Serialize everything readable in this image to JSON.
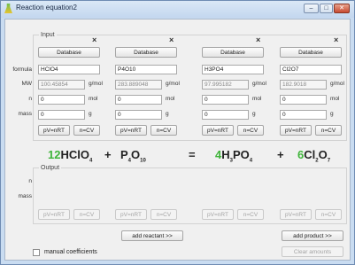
{
  "window": {
    "title": "Reaction equation2",
    "buttons": {
      "minimize": "‒",
      "maximize": "□",
      "close": "✕"
    }
  },
  "input_group": {
    "label": "Input"
  },
  "output_group": {
    "label": "Output"
  },
  "row_labels": {
    "formula": "formula",
    "mw": "MW",
    "n": "n",
    "mass": "mass"
  },
  "output_row_labels": {
    "n": "n",
    "mass": "mass"
  },
  "compounds": [
    {
      "database": "Database",
      "formula": "HClO4",
      "mw": "100.45854",
      "mw_unit": "g/mol",
      "n": "0",
      "n_unit": "mol",
      "mass": "0",
      "mass_unit": "g",
      "pv": "pV=nRT",
      "ncv": "n=CV"
    },
    {
      "database": "Database",
      "formula": "P4O10",
      "mw": "283.889048",
      "mw_unit": "g/mol",
      "n": "0",
      "n_unit": "mol",
      "mass": "0",
      "mass_unit": "g",
      "pv": "pV=nRT",
      "ncv": "n=CV"
    },
    {
      "database": "Database",
      "formula": "H3PO4",
      "mw": "97.995182",
      "mw_unit": "g/mol",
      "n": "0",
      "n_unit": "mol",
      "mass": "0",
      "mass_unit": "g",
      "pv": "pV=nRT",
      "ncv": "n=CV"
    },
    {
      "database": "Database",
      "formula": "Cl2O7",
      "mw": "182.9018",
      "mw_unit": "g/mol",
      "n": "0",
      "n_unit": "mol",
      "mass": "0",
      "mass_unit": "g",
      "pv": "pV=nRT",
      "ncv": "n=CV"
    }
  ],
  "equation": {
    "terms": [
      {
        "coef": "12",
        "parts": [
          [
            "H",
            ""
          ],
          [
            "Cl",
            ""
          ],
          [
            "O",
            "4"
          ]
        ]
      },
      {
        "coef": "",
        "parts": [
          [
            "P",
            "4"
          ],
          [
            "O",
            "10"
          ]
        ]
      },
      {
        "coef": "4",
        "parts": [
          [
            "H",
            "3"
          ],
          [
            "P",
            ""
          ],
          [
            "O",
            "4"
          ]
        ]
      },
      {
        "coef": "6",
        "parts": [
          [
            "Cl",
            "2"
          ],
          [
            "O",
            "7"
          ]
        ]
      }
    ],
    "plus": "+",
    "equals": "="
  },
  "output_buttons": {
    "pv": "pV=nRT",
    "ncv": "n=CV"
  },
  "bottom": {
    "add_reactant": "add reactant >>",
    "add_product": "add product >>",
    "manual_coefficients": "manual coefficients",
    "clear_amounts": "Clear amounts"
  },
  "colors": {
    "coefficient": "#3fb43a",
    "close_button": "#c74a30"
  }
}
